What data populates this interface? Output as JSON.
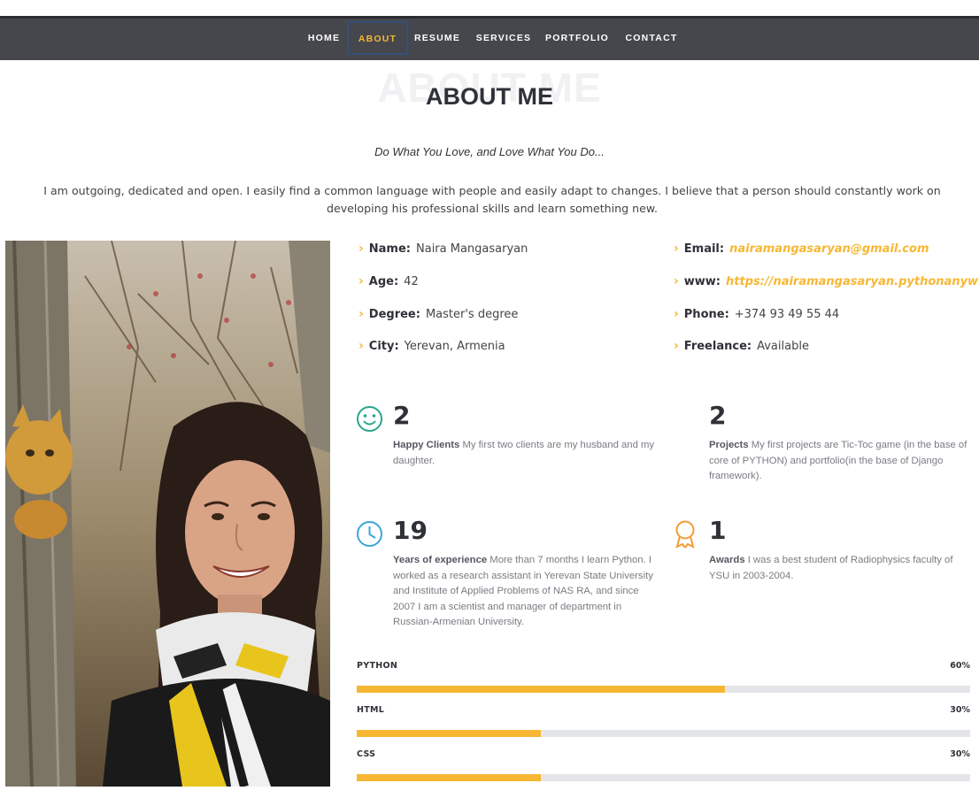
{
  "nav": {
    "items": [
      "HOME",
      "ABOUT",
      "RESUME",
      "SERVICES",
      "PORTFOLIO",
      "CONTACT"
    ],
    "active": "ABOUT"
  },
  "section": {
    "bg_title": "ABOUT ME",
    "title": "ABOUT ME"
  },
  "tagline": "Do What You Love, and Love What You Do...",
  "intro": "I am outgoing, dedicated and open. I easily find a common language with people and easily adapt to changes. I believe that a person should constantly work on developing his professional skills and learn something new.",
  "info": {
    "name": {
      "label": "Name:",
      "value": "Naira Mangasaryan"
    },
    "age": {
      "label": "Age:",
      "value": "42"
    },
    "degree": {
      "label": "Degree:",
      "value": "Master's degree"
    },
    "city": {
      "label": "City:",
      "value": "Yerevan, Armenia"
    },
    "email": {
      "label": "Email:",
      "value": "nairamangasaryan@gmail.com"
    },
    "www": {
      "label": "www:",
      "value": "https://nairamangasaryan.pythonanywhere.c"
    },
    "phone": {
      "label": "Phone:",
      "value": "+374 93 49 55 44"
    },
    "freelance": {
      "label": "Freelance:",
      "value": "Available"
    }
  },
  "counts": {
    "clients": {
      "number": "2",
      "title": "Happy Clients",
      "text": "My first two clients are my husband and my daughter.",
      "icon": "smile-icon"
    },
    "projects": {
      "number": "2",
      "title": "Projects",
      "text": "My first projects are Tic-Toc game (in the base of core of PYTHON) and portfolio(in the base of Django framework).",
      "icon": "none"
    },
    "experience": {
      "number": "19",
      "title": "Years of experience",
      "text": "More than 7 months I learn Python. I worked as a research assistant in Yerevan State University and Institute of Applied Problems of NAS RA, and since 2007 I am a scientist and manager of department in Russian-Armenian University.",
      "icon": "clock-icon"
    },
    "awards": {
      "number": "1",
      "title": "Awards",
      "text": "I was a best student of Radiophysics faculty of YSU in 2003-2004.",
      "icon": "award-icon"
    }
  },
  "skills": [
    {
      "name": "PYTHON",
      "value": "60%",
      "level": 0.6
    },
    {
      "name": "HTML",
      "value": "30%",
      "level": 0.3
    },
    {
      "name": "CSS",
      "value": "30%",
      "level": 0.3
    }
  ],
  "colors": {
    "accent": "#f7b733",
    "nav_bg": "#45474c",
    "smile_icon": "#2aa58c",
    "clock_icon": "#3aa7d8",
    "award_icon": "#f39c33",
    "heading": "#2f3138"
  }
}
